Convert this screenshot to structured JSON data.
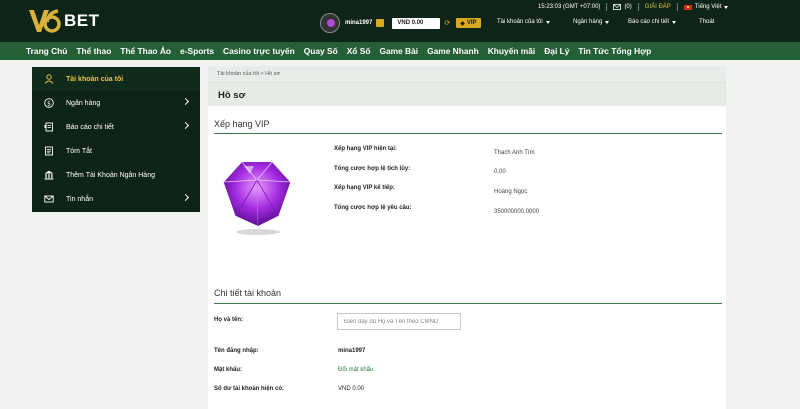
{
  "header": {
    "logo_text": "BET",
    "time": "15:23:03 (GMT +07:00)",
    "messages_count": "(0)",
    "help": "GIẢI ĐÁP",
    "language": "Tiếng Việt",
    "username": "mina1997",
    "balance": "VND 0.00",
    "vip_label": "VIP",
    "menu": {
      "account": "Tài khoản của tôi",
      "bank": "Ngân hàng",
      "report": "Báo cáo chi tiết",
      "logout": "Thoát"
    }
  },
  "nav": [
    "Trang Chủ",
    "Thể thao",
    "Thể Thao Ảo",
    "e-Sports",
    "Casino trực tuyến",
    "Quay Số",
    "Xổ Số",
    "Game Bài",
    "Game Nhanh",
    "Khuyến mãi",
    "Đại Lý",
    "Tin Tức Tổng Hợp"
  ],
  "sidebar": {
    "items": [
      {
        "label": "Tài khoản của tôi",
        "icon": "user-icon"
      },
      {
        "label": "Ngân hàng",
        "icon": "dollar-icon"
      },
      {
        "label": "Báo cáo chi tiết",
        "icon": "report-icon"
      },
      {
        "label": "Tóm Tắt",
        "icon": "summary-icon"
      },
      {
        "label": "Thêm Tài Khoản Ngân Hàng",
        "icon": "bank-icon"
      },
      {
        "label": "Tin nhắn",
        "icon": "mail-icon"
      }
    ]
  },
  "main": {
    "breadcrumb": "Tài khoản của tôi > Hồ sơ",
    "page_title": "Hồ sơ",
    "vip": {
      "title": "Xếp hạng VIP",
      "current_label": "Xếp hạng VIP hiện tại:",
      "current_value": "Thạch Anh Tím",
      "total_bet_label": "Tổng cược hợp lệ tích lũy:",
      "total_bet_value": "0.00",
      "next_label": "Xếp hạng VIP kế tiếp:",
      "next_value": "Hoàng Ngọc",
      "required_label": "Tổng cược hợp lệ yêu cầu:",
      "required_value": "350000000.0000"
    },
    "account": {
      "title": "Chi tiết tài khoản",
      "fullname_label": "Họ và tên:",
      "fullname_placeholder": "Điền đầy đủ Họ và Tên theo CMND",
      "username_label": "Tên đăng nhập:",
      "username_value": "mina1997",
      "password_label": "Mật khẩu:",
      "password_link": "Đổi mật khẩu",
      "balance_label": "Số dư tài khoản hiện có:",
      "balance_value": "VND 0.00"
    }
  },
  "colors": {
    "header_bg": "#0f2419",
    "nav_bg": "#245f35",
    "accent_gold": "#d9a920",
    "sidebar_active": "#e8c341",
    "link_green": "#2a7a3b"
  }
}
